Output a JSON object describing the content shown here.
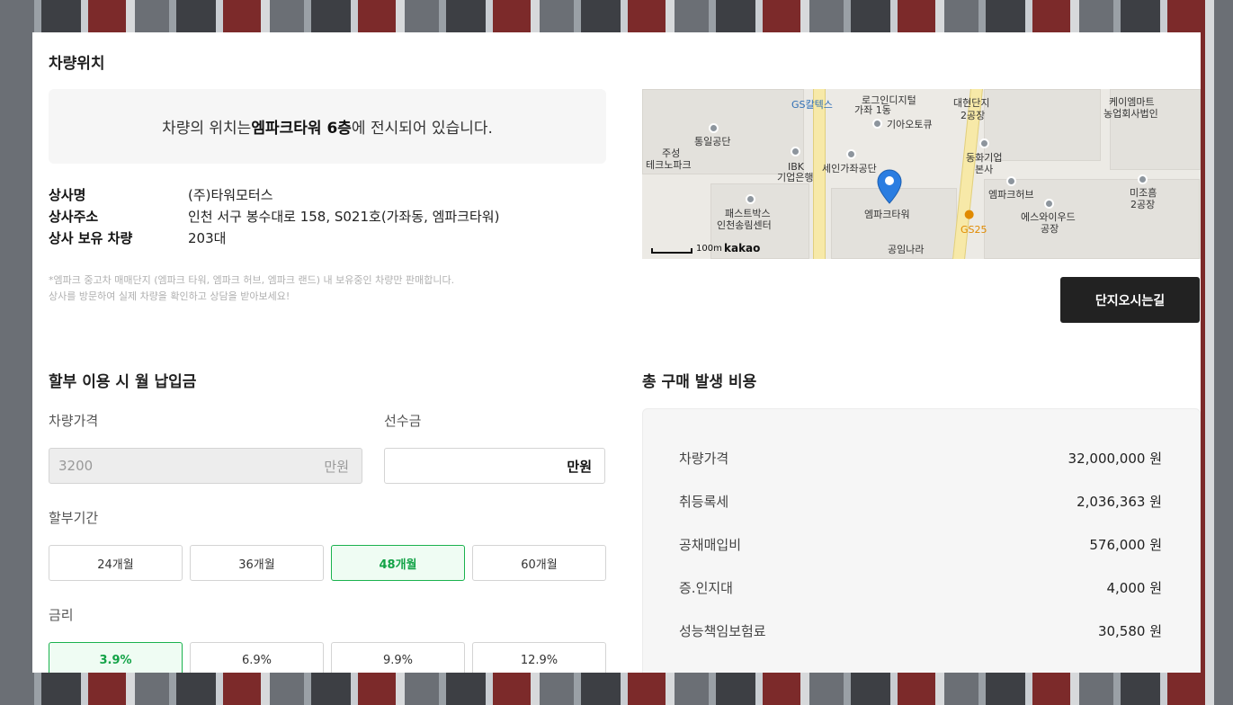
{
  "location": {
    "title": "차량위치",
    "notice_pre": "차량의 위치는 ",
    "notice_bold": "엠파크타워 6층",
    "notice_post": "에 전시되어 있습니다.",
    "dealer": [
      {
        "label": "상사명",
        "value": "(주)타워모터스"
      },
      {
        "label": "상사주소",
        "value": "인천 서구 봉수대로 158, S021호(가좌동, 엠파크타워)"
      },
      {
        "label": "상사 보유 차량",
        "value": "203대"
      }
    ],
    "fine_print": [
      "*엠파크 중고차 매매단지 (엠파크 타워, 엠파크 허브, 엠파크 랜드) 내 보유중인 차량만 판매합니다.",
      "상사를 방문하여 실제 차량을 확인하고 상담을 받아보세요!"
    ],
    "directions_button": "단지오시는길"
  },
  "map": {
    "labels": {
      "gs_caltex": "GS칼텍스",
      "logistics": "로그인디지털",
      "gajwa": "가좌 1동",
      "daehyeon": "대현단지",
      "daehyeon2": "2공장",
      "kmart1": "케이엠마트",
      "kmart2": "농업회사법인",
      "tongil": "통일공단",
      "jusung1": "주성",
      "jusung2": "테크노파크",
      "kia": "기아오토큐",
      "ibk1": "IBK",
      "ibk2": "기업은행",
      "sein": "세인가좌공단",
      "donghwa1": "동화기업",
      "donghwa2": "본사",
      "hub": "엠파크허브",
      "mijo1": "미조흠",
      "mijo2": "2공장",
      "fastbox1": "패스트박스",
      "fastbox2": "인천송림센터",
      "tower": "엠파크타워",
      "esswood1": "에스와이우드",
      "esswood2": "공장",
      "gs25": "GS25",
      "gongim": "공임나라"
    },
    "scale": "100m",
    "provider": "kakao"
  },
  "installment": {
    "title": "할부 이용 시 월 납입금",
    "price_label": "차량가격",
    "price_value": "3200",
    "price_unit": "만원",
    "down_label": "선수금",
    "down_value": "",
    "down_unit": "만원",
    "term_label": "할부기간",
    "terms": [
      "24개월",
      "36개월",
      "48개월",
      "60개월"
    ],
    "selected_term": "48개월",
    "rate_label": "금리",
    "rates": [
      "3.9%",
      "6.9%",
      "9.9%",
      "12.9%"
    ],
    "selected_rate": "3.9%"
  },
  "costs": {
    "title": "총 구매 발생 비용",
    "rows": [
      {
        "label": "차량가격",
        "amount": "32,000,000 원"
      },
      {
        "label": "취등록세",
        "amount": "2,036,363 원"
      },
      {
        "label": "공채매입비",
        "amount": "576,000 원"
      },
      {
        "label": "증.인지대",
        "amount": "4,000 원"
      },
      {
        "label": "성능책임보험료",
        "amount": "30,580 원"
      }
    ]
  }
}
